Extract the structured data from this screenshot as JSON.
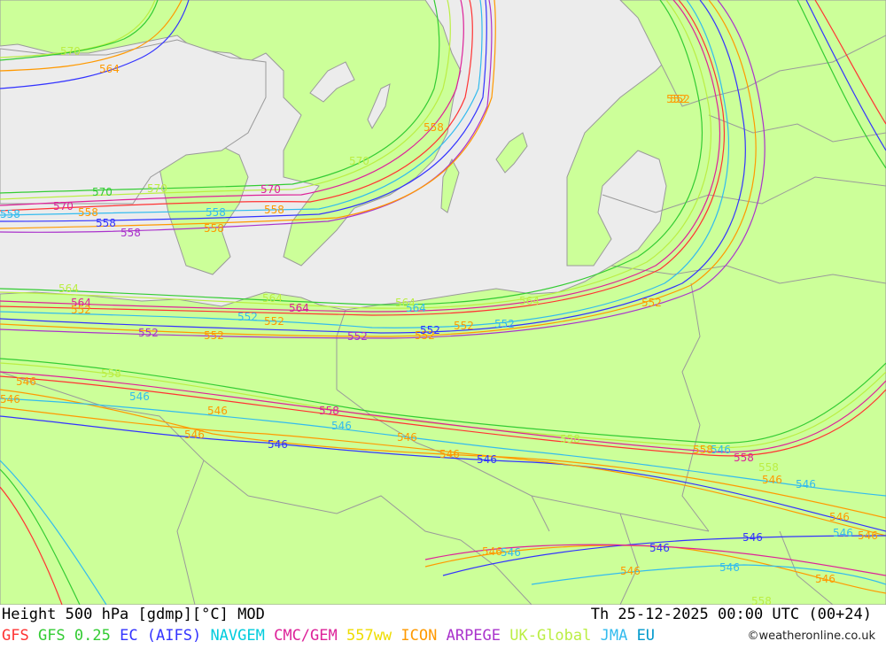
{
  "title": "Height 500 hPa [gdmp][°C] MOD",
  "datetime": "Th 25-12-2025 00:00 UTC (00+24)",
  "credit": "©weatheronline.co.uk",
  "legend": [
    {
      "label": "GFS",
      "color": "#ff3333"
    },
    {
      "label": "GFS 0.25",
      "color": "#33cc33"
    },
    {
      "label": "EC (AIFS)",
      "color": "#3333ff"
    },
    {
      "label": "NAVGEM",
      "color": "#00ccdd"
    },
    {
      "label": "CMC/GEM",
      "color": "#dd2299"
    },
    {
      "label": "557ww",
      "color": "#eedd00"
    },
    {
      "label": "ICON",
      "color": "#ff9900"
    },
    {
      "label": "ARPEGE",
      "color": "#aa33cc"
    },
    {
      "label": "UK-Global",
      "color": "#bbee44"
    },
    {
      "label": "JMA",
      "color": "#33bbee"
    },
    {
      "label": "EU",
      "color": "#0099cc"
    }
  ],
  "colors": {
    "land": "#ccff99",
    "sea": "#ececec",
    "border": "#9a9a9a"
  },
  "contour_labels": [
    {
      "text": "570",
      "color": "#bbee44"
    },
    {
      "text": "564",
      "color": "#ff9900"
    },
    {
      "text": "570",
      "color": "#33cc33"
    },
    {
      "text": "570",
      "color": "#bbee44"
    },
    {
      "text": "570",
      "color": "#dd2299"
    },
    {
      "text": "570",
      "color": "#dd2299"
    },
    {
      "text": "570",
      "color": "#bbee44"
    },
    {
      "text": "558",
      "color": "#ff9900"
    },
    {
      "text": "558",
      "color": "#33bbee"
    },
    {
      "text": "558",
      "color": "#3333ff"
    },
    {
      "text": "558",
      "color": "#aa33cc"
    },
    {
      "text": "558",
      "color": "#ff9900"
    },
    {
      "text": "558",
      "color": "#33bbee"
    },
    {
      "text": "558",
      "color": "#ff9900"
    },
    {
      "text": "558",
      "color": "#ff9900"
    },
    {
      "text": "564",
      "color": "#bbee44"
    },
    {
      "text": "564",
      "color": "#dd2299"
    },
    {
      "text": "552",
      "color": "#ff9900"
    },
    {
      "text": "564",
      "color": "#bbee44"
    },
    {
      "text": "564",
      "color": "#dd2299"
    },
    {
      "text": "564",
      "color": "#33bbee"
    },
    {
      "text": "564",
      "color": "#bbee44"
    },
    {
      "text": "564",
      "color": "#bbee44"
    },
    {
      "text": "552",
      "color": "#33bbee"
    },
    {
      "text": "552",
      "color": "#ff9900"
    },
    {
      "text": "552",
      "color": "#aa33cc"
    },
    {
      "text": "552",
      "color": "#ff9900"
    },
    {
      "text": "552",
      "color": "#aa33cc"
    },
    {
      "text": "552",
      "color": "#ff9900"
    },
    {
      "text": "552",
      "color": "#3333ff"
    },
    {
      "text": "552",
      "color": "#ff9900"
    },
    {
      "text": "552",
      "color": "#33bbee"
    },
    {
      "text": "552",
      "color": "#ff9900"
    },
    {
      "text": "552",
      "color": "#ff9900"
    },
    {
      "text": "546",
      "color": "#ff9900"
    },
    {
      "text": "558",
      "color": "#bbee44"
    },
    {
      "text": "546",
      "color": "#ff9900"
    },
    {
      "text": "546",
      "color": "#33bbee"
    },
    {
      "text": "546",
      "color": "#33bbee"
    },
    {
      "text": "546",
      "color": "#ff9900"
    },
    {
      "text": "558",
      "color": "#dd2299"
    },
    {
      "text": "546",
      "color": "#33bbee"
    },
    {
      "text": "546",
      "color": "#ff9900"
    },
    {
      "text": "546",
      "color": "#3333ff"
    },
    {
      "text": "546",
      "color": "#ff9900"
    },
    {
      "text": "546",
      "color": "#3333ff"
    },
    {
      "text": "546",
      "color": "#ff9900"
    },
    {
      "text": "558",
      "color": "#bbee44"
    },
    {
      "text": "546",
      "color": "#33bbee"
    },
    {
      "text": "558",
      "color": "#ff9900"
    },
    {
      "text": "558",
      "color": "#dd2299"
    },
    {
      "text": "558",
      "color": "#bbee44"
    },
    {
      "text": "546",
      "color": "#ff9900"
    },
    {
      "text": "546",
      "color": "#33bbee"
    },
    {
      "text": "546",
      "color": "#ff9900"
    },
    {
      "text": "546",
      "color": "#3333ff"
    },
    {
      "text": "546",
      "color": "#33bbee"
    },
    {
      "text": "546",
      "color": "#ff9900"
    },
    {
      "text": "546",
      "color": "#3333ff"
    },
    {
      "text": "546",
      "color": "#ff9900"
    },
    {
      "text": "546",
      "color": "#33bbee"
    },
    {
      "text": "546",
      "color": "#ff9900"
    },
    {
      "text": "558",
      "color": "#bbee44"
    },
    {
      "text": "546",
      "color": "#ff9900"
    },
    {
      "text": "552",
      "color": "#ff9900"
    }
  ]
}
